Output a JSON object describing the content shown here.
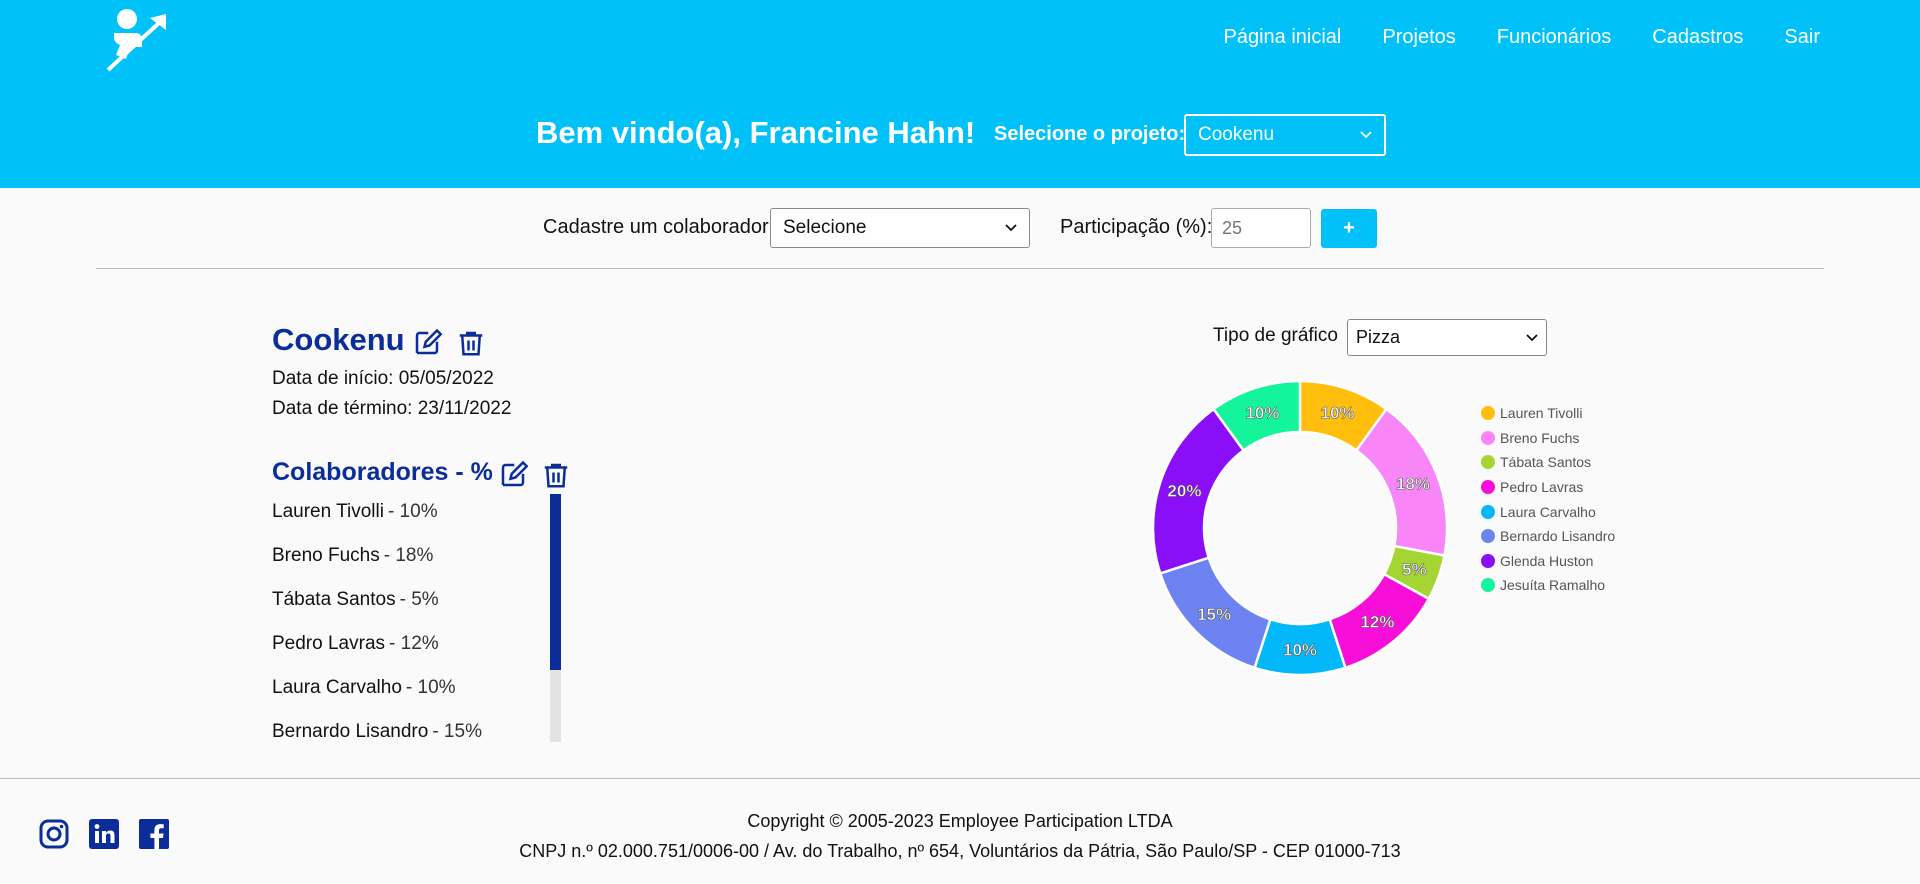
{
  "nav": {
    "items": [
      "Página inicial",
      "Projetos",
      "Funcionários",
      "Cadastros",
      "Sair"
    ]
  },
  "header": {
    "welcome": "Bem vindo(a), Francine Hahn!",
    "select_label": "Selecione o projeto:",
    "selected_project": "Cookenu"
  },
  "form": {
    "collab_label": "Cadastre um colaborador:",
    "collab_selected": "Selecione",
    "participation_label": "Participação (%):",
    "participation_placeholder": "25",
    "add_label": "+"
  },
  "project": {
    "name": "Cookenu",
    "start_date": "Data de início: 05/05/2022",
    "end_date": "Data de término: 23/11/2022",
    "collab_title": "Colaboradores - %",
    "collaborators": [
      {
        "name": "Lauren Tivolli",
        "pct": "- 10%"
      },
      {
        "name": "Breno Fuchs",
        "pct": "- 18%"
      },
      {
        "name": "Tábata Santos",
        "pct": "- 5%"
      },
      {
        "name": "Pedro Lavras",
        "pct": "- 12%"
      },
      {
        "name": "Laura Carvalho",
        "pct": "- 10%"
      },
      {
        "name": "Bernardo Lisandro",
        "pct": "- 15%"
      }
    ],
    "scroll_fraction": 0.71
  },
  "chart_controls": {
    "type_label": "Tipo de gráfico",
    "type_selected": "Pizza"
  },
  "chart_data": {
    "type": "pie",
    "categories": [
      "Lauren Tivolli",
      "Breno Fuchs",
      "Tábata Santos",
      "Pedro Lavras",
      "Laura Carvalho",
      "Bernardo Lisandro",
      "Glenda Huston",
      "Jesuíta Ramalho"
    ],
    "values": [
      10,
      18,
      5,
      12,
      10,
      15,
      20,
      10
    ],
    "colors": [
      "#ffbe0b",
      "#f986f9",
      "#a5d533",
      "#f70fd9",
      "#03b7fb",
      "#6d83f2",
      "#8a0ef7",
      "#14f49a"
    ],
    "legend": "right"
  },
  "footer": {
    "copyright": "Copyright © 2005-2023 Employee Participation LTDA",
    "address": "CNPJ n.º 02.000.751/0006-00 / Av. do Trabalho, nº 654, Voluntários da Pátria, São Paulo/SP - CEP 01000-713",
    "icons": [
      "instagram-icon",
      "linkedin-icon",
      "facebook-icon"
    ]
  }
}
